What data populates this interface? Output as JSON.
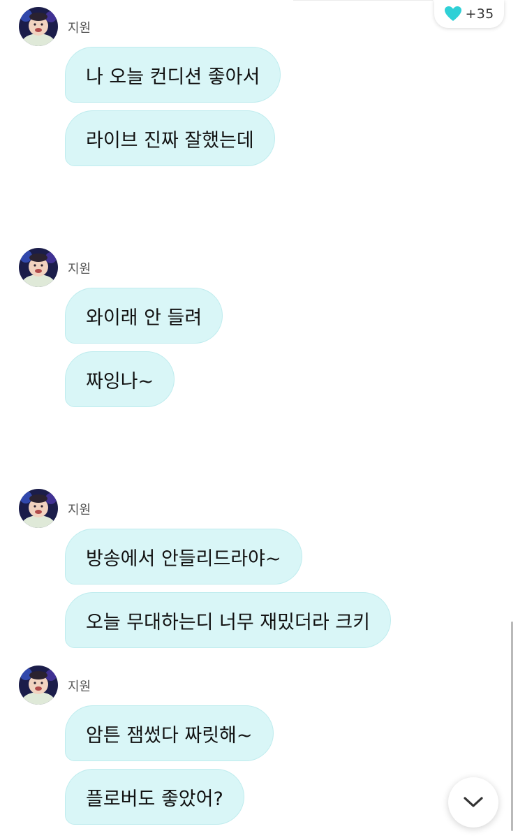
{
  "header": {
    "like_count": "+35",
    "like_icon": "heart-icon",
    "like_color": "#2fd0d6"
  },
  "colors": {
    "bubble_bg": "#d9f6f7",
    "bubble_border": "#bfecee"
  },
  "messages": [
    {
      "sender": "지원",
      "bubbles": [
        "나 오늘 컨디션 좋아서",
        "라이브 진짜 잘했는데"
      ]
    },
    {
      "sender": "지원",
      "bubbles": [
        "와이래 안 들려",
        "짜잉나~"
      ]
    },
    {
      "sender": "지원",
      "bubbles": [
        "방송에서 안들리드라야~",
        "오늘 무대하는디 너무 재밌더라 크키"
      ]
    },
    {
      "sender": "지원",
      "bubbles": [
        "암튼 잼썼다 짜릿해~",
        "플로버도 좋았어?"
      ]
    }
  ],
  "controls": {
    "scroll_down_icon": "chevron-down-icon"
  }
}
